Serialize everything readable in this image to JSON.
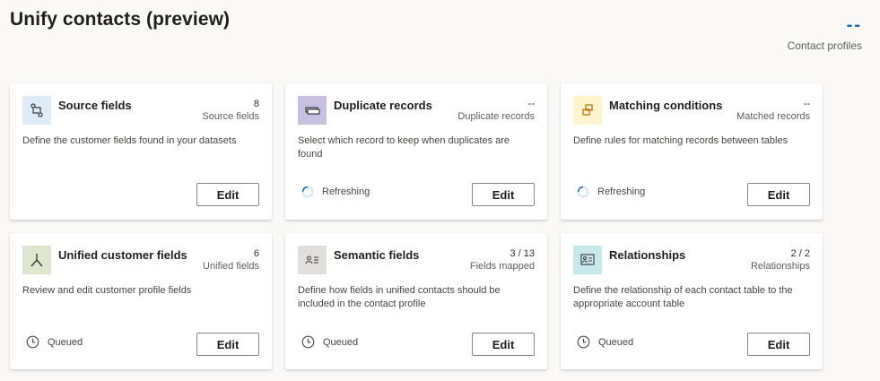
{
  "page": {
    "title": "Unify contacts (preview)",
    "summary_value": "--",
    "summary_label": "Contact profiles"
  },
  "colors": {
    "accent": "#0f6cbd",
    "source_icon_bg": "#deecf9",
    "duplicate_icon_bg": "#c8c0e0",
    "matching_icon_bg": "#fff4ce",
    "unified_icon_bg": "#dfe6cf",
    "semantic_icon_bg": "#e1dfdd",
    "relationships_icon_bg": "#c7e9ec"
  },
  "cards": [
    {
      "title": "Source fields",
      "count": "8",
      "count_label": "Source fields",
      "description": "Define the customer fields found in your datasets",
      "status": "",
      "icon": "source-fields-icon",
      "button": "Edit"
    },
    {
      "title": "Duplicate records",
      "count": "--",
      "count_label": "Duplicate records",
      "description": "Select which record to keep when duplicates are found",
      "status": "Refreshing",
      "icon": "duplicate-records-icon",
      "button": "Edit"
    },
    {
      "title": "Matching conditions",
      "count": "--",
      "count_label": "Matched records",
      "description": "Define rules for matching records between tables",
      "status": "Refreshing",
      "icon": "matching-conditions-icon",
      "button": "Edit"
    },
    {
      "title": "Unified customer fields",
      "count": "6",
      "count_label": "Unified fields",
      "description": "Review and edit customer profile fields",
      "status": "Queued",
      "icon": "merge-icon",
      "button": "Edit"
    },
    {
      "title": "Semantic fields",
      "count": "3 / 13",
      "count_label": "Fields mapped",
      "description": "Define how fields in unified contacts should be included in the contact profile",
      "status": "Queued",
      "icon": "semantic-fields-icon",
      "button": "Edit"
    },
    {
      "title": "Relationships",
      "count": "2 / 2",
      "count_label": "Relationships",
      "description": "Define the relationship of each contact table to the appropriate account table",
      "status": "Queued",
      "icon": "relationships-icon",
      "button": "Edit"
    }
  ]
}
